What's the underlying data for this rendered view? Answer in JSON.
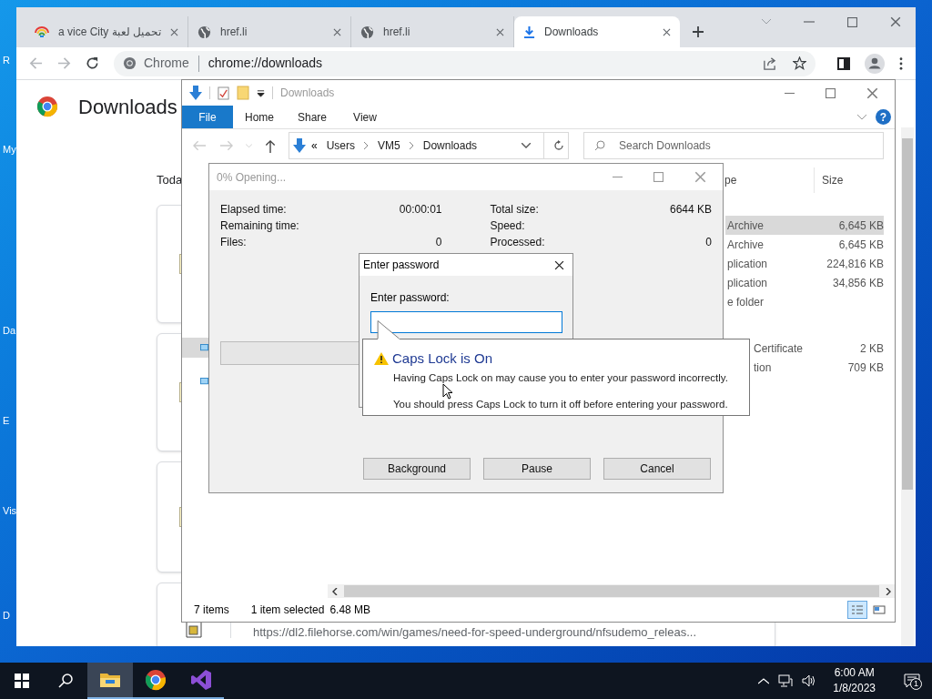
{
  "desktop_icons": [
    {
      "label": "R"
    },
    {
      "label": "My"
    },
    {
      "label": "Da"
    },
    {
      "label": "E"
    },
    {
      "label": "Vis"
    },
    {
      "label": "D"
    }
  ],
  "browser": {
    "tabs": [
      {
        "kind": "rainbow",
        "title": "a vice City تحميل لعبة",
        "selected": false
      },
      {
        "kind": "globe",
        "title": "href.li",
        "selected": false
      },
      {
        "kind": "globe",
        "title": "href.li",
        "selected": false
      },
      {
        "kind": "download",
        "title": "Downloads",
        "selected": true
      }
    ],
    "omnibox": {
      "origin": "Chrome",
      "url": "chrome://downloads"
    },
    "page": {
      "title": "Downloads",
      "section": "Toda",
      "download_url": "https://dl2.filehorse.com/win/games/need-for-speed-underground/nfsudemo_releas..."
    }
  },
  "explorer": {
    "title": "Downloads",
    "ribbon_tabs": [
      {
        "label": "File",
        "selected": true
      },
      {
        "label": "Home",
        "selected": false
      },
      {
        "label": "Share",
        "selected": false
      },
      {
        "label": "View",
        "selected": false
      }
    ],
    "help": "?",
    "path_overflow": "«",
    "breadcrumb": [
      "Users",
      "VM5",
      "Downloads"
    ],
    "search": {
      "placeholder": "Search Downloads"
    },
    "nav_pane": [
      {
        "selected": true
      },
      {
        "selected": false
      }
    ],
    "columns": [
      "pe",
      "Size"
    ],
    "groups": [
      {
        "rows": [
          {
            "type": "Archive",
            "size": "6,645 KB",
            "selected": true
          },
          {
            "type": "Archive",
            "size": "6,645 KB",
            "selected": false
          },
          {
            "type": "plication",
            "size": "224,816 KB",
            "selected": false
          },
          {
            "type": "plication",
            "size": "34,856 KB",
            "selected": false
          },
          {
            "type": "e folder",
            "selected": false
          }
        ]
      },
      {
        "rows": [
          {
            "type": "Certificate",
            "size": "2 KB",
            "selected": false
          },
          {
            "type": "tion",
            "size": "709 KB",
            "selected": false
          }
        ]
      }
    ],
    "status": {
      "count": "7 items",
      "selection": "1 item selected",
      "size": "6.48 MB"
    },
    "views": [
      {
        "kind": "details",
        "selected": true
      },
      {
        "kind": "tiles",
        "selected": false
      }
    ]
  },
  "progress": {
    "title": "0% Opening...",
    "stats_left": [
      {
        "label": "Elapsed time:",
        "value": "00:00:01"
      },
      {
        "label": "Remaining time:"
      },
      {
        "label": "Files:",
        "value": "0"
      }
    ],
    "stats_right": [
      {
        "label": "Total size:",
        "value": "6644 KB"
      },
      {
        "label": "Speed:"
      },
      {
        "label": "Processed:",
        "value": "0"
      }
    ],
    "level": 0,
    "buttons": [
      "Background",
      "Pause",
      "Cancel"
    ]
  },
  "password": {
    "title": "Enter password",
    "label": "Enter password:"
  },
  "balloon": {
    "title": "Caps Lock is On",
    "lines": [
      "Having Caps Lock on may cause you to enter your password incorrectly.",
      "You should press Caps Lock to turn it off before entering your password."
    ]
  },
  "taskbar": {
    "apps": [
      {
        "kind": "explorer",
        "selected": true
      },
      {
        "kind": "chrome",
        "selected": false
      },
      {
        "kind": "studio",
        "selected": false
      }
    ],
    "time": "6:00 AM",
    "date": "1/8/2023",
    "notifications": "1"
  }
}
